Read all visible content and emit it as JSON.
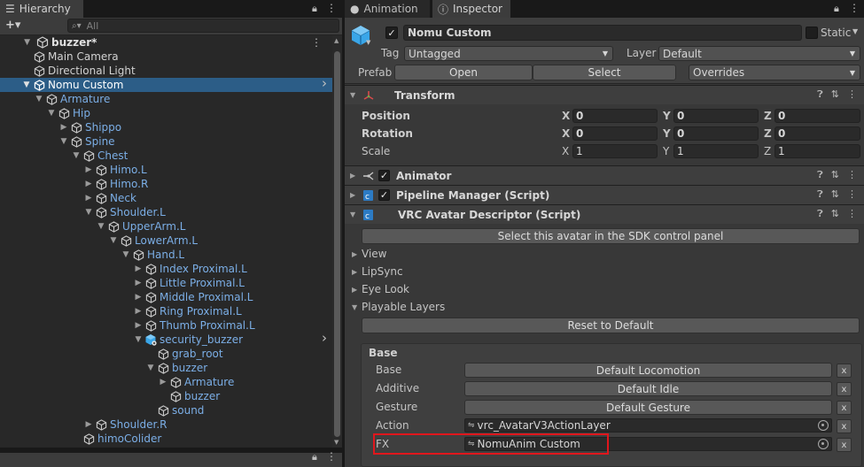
{
  "hierarchy": {
    "tab_label": "Hierarchy",
    "add_label": "+▾",
    "search_placeholder": "All",
    "scene_name": "buzzer*",
    "items": [
      {
        "label": "Main Camera",
        "color": "white"
      },
      {
        "label": "Directional Light",
        "color": "white"
      },
      {
        "label": "Nomu Custom",
        "color": "white"
      },
      {
        "label": "Armature",
        "color": "blue"
      },
      {
        "label": "Hip",
        "color": "blue"
      },
      {
        "label": "Shippo",
        "color": "blue"
      },
      {
        "label": "Spine",
        "color": "blue"
      },
      {
        "label": "Chest",
        "color": "blue"
      },
      {
        "label": "Himo.L",
        "color": "blue"
      },
      {
        "label": "Himo.R",
        "color": "blue"
      },
      {
        "label": "Neck",
        "color": "blue"
      },
      {
        "label": "Shoulder.L",
        "color": "blue"
      },
      {
        "label": "UpperArm.L",
        "color": "blue"
      },
      {
        "label": "LowerArm.L",
        "color": "blue"
      },
      {
        "label": "Hand.L",
        "color": "blue"
      },
      {
        "label": "Index Proximal.L",
        "color": "blue"
      },
      {
        "label": "Little Proximal.L",
        "color": "blue"
      },
      {
        "label": "Middle Proximal.L",
        "color": "blue"
      },
      {
        "label": "Ring Proximal.L",
        "color": "blue"
      },
      {
        "label": "Thumb Proximal.L",
        "color": "blue"
      },
      {
        "label": "security_buzzer",
        "color": "blue"
      },
      {
        "label": "grab_root",
        "color": "blue"
      },
      {
        "label": "buzzer",
        "color": "blue"
      },
      {
        "label": "Armature",
        "color": "blue"
      },
      {
        "label": "buzzer",
        "color": "blue"
      },
      {
        "label": "sound",
        "color": "blue"
      },
      {
        "label": "Shoulder.R",
        "color": "blue"
      },
      {
        "label": "himoColider",
        "color": "blue"
      }
    ]
  },
  "tabs": {
    "animation": "Animation",
    "inspector": "Inspector"
  },
  "inspector": {
    "object_name": "Nomu Custom",
    "static_label": "Static",
    "tag_label": "Tag",
    "tag_value": "Untagged",
    "layer_label": "Layer",
    "layer_value": "Default",
    "prefab_label": "Prefab",
    "prefab_open": "Open",
    "prefab_select": "Select",
    "prefab_overrides": "Overrides",
    "transform": {
      "title": "Transform",
      "position_label": "Position",
      "rotation_label": "Rotation",
      "scale_label": "Scale",
      "position": {
        "x": "0",
        "y": "0",
        "z": "0"
      },
      "rotation": {
        "x": "0",
        "y": "0",
        "z": "0"
      },
      "scale": {
        "x": "1",
        "y": "1",
        "z": "1"
      }
    },
    "animator_title": "Animator",
    "pipeline_title": "Pipeline Manager (Script)",
    "descriptor": {
      "title": "VRC Avatar Descriptor (Script)",
      "sdk_button": "Select this avatar in the SDK control panel",
      "foldouts": [
        "View",
        "LipSync",
        "Eye Look",
        "Playable Layers"
      ],
      "reset_button": "Reset to Default",
      "base_label": "Base",
      "layers": [
        {
          "label": "Base",
          "value": "Default Locomotion",
          "kind": "button"
        },
        {
          "label": "Additive",
          "value": "Default Idle",
          "kind": "button"
        },
        {
          "label": "Gesture",
          "value": "Default Gesture",
          "kind": "button"
        },
        {
          "label": "Action",
          "value": "vrc_AvatarV3ActionLayer",
          "kind": "object"
        },
        {
          "label": "FX",
          "value": "NomuAnim Custom",
          "kind": "object"
        }
      ],
      "x_label": "x"
    }
  },
  "colors": {
    "selection": "#2c5d87",
    "blue_text": "#7baee6",
    "highlight_box": "#e0161c"
  }
}
